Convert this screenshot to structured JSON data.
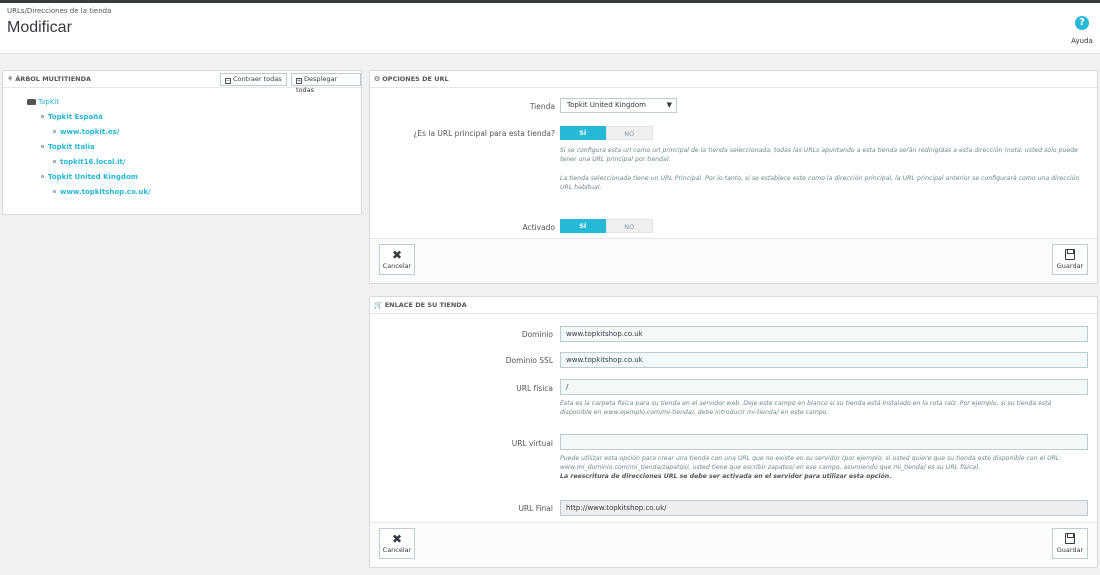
{
  "header": {
    "breadcrumb": "URLs/Direcciones de la tienda",
    "title": "Modificar",
    "help_label": "Ayuda",
    "help_icon": "?"
  },
  "tree": {
    "title": "ÁRBOL MULTITIENDA",
    "collapse_label": "Contraer todas",
    "expand_label": "Desplegar todas",
    "root": "TopKit",
    "items": [
      {
        "label": "Topkit España"
      },
      {
        "label": "www.topkit.es/"
      },
      {
        "label": "Topkit Italia"
      },
      {
        "label": "topkit16.local.it/"
      },
      {
        "label": "Topkit United Kingdom"
      },
      {
        "label": "www.topkitshop.co.uk/"
      }
    ]
  },
  "url_options": {
    "title": "OPCIONES DE URL",
    "shop_label": "Tienda",
    "shop_value": "Topkit United Kingdom",
    "main_label": "¿Es la URL principal para esta tienda?",
    "yes": "SÍ",
    "no": "NO",
    "help1": "Si se configura esta url como url principal de la tienda seleccionada, todas las URLs apuntando a esta tienda serán redirigidas a esta dirección (nota: usted sólo puede tener una URL principal por tienda).",
    "help2": "La tienda seleccionada tiene un URL Principal. Por lo tanto, si se establece este como la dirección principal, la URL principal anterior se configurará como una dirección URL habitual.",
    "active_label": "Activado",
    "cancel": "Cancelar",
    "save": "Guardar",
    "cancel_icon": "✖"
  },
  "shop_link": {
    "title": "ENLACE DE SU TIENDA",
    "domain_label": "Dominio",
    "domain_value": "www.topkitshop.co.uk",
    "ssl_label": "Dominio SSL",
    "ssl_value": "www.topkitshop.co.uk",
    "physical_label": "URL física",
    "physical_value": "/",
    "physical_help": "Esta es la carpeta física para su tienda en el servidor web. Deje este campo en blanco si su tienda está instalado en la ruta raíz. Por ejemplo, si su tienda está disponible en www.ejemplo.com/mi-tienda/, debe introducir mi-tienda/ en este campo.",
    "virtual_label": "URL virtual",
    "virtual_value": "",
    "virtual_help": "Puede utilizar esta opción para crear una tienda con una URL que no existe en su servidor (por ejemplo: si usted quiere que su tienda esté disponible con el URL: www.mi_dominio.com/mi_tienda/zapatos/, usted tiene que escribir zapatos/ en ese campo, asumiendo que mi_tienda/ es su URL física).",
    "virtual_help_bold": "La reescritura de direcciones URL se debe ser activada en el servidor para utilizar esta opción.",
    "final_label": "URL Final",
    "final_value": "http://www.topkitshop.co.uk/",
    "cancel": "Cancelar",
    "save": "Guardar",
    "cancel_icon": "✖"
  },
  "colors": {
    "accent": "#25b9d7",
    "dark": "#363a41"
  }
}
